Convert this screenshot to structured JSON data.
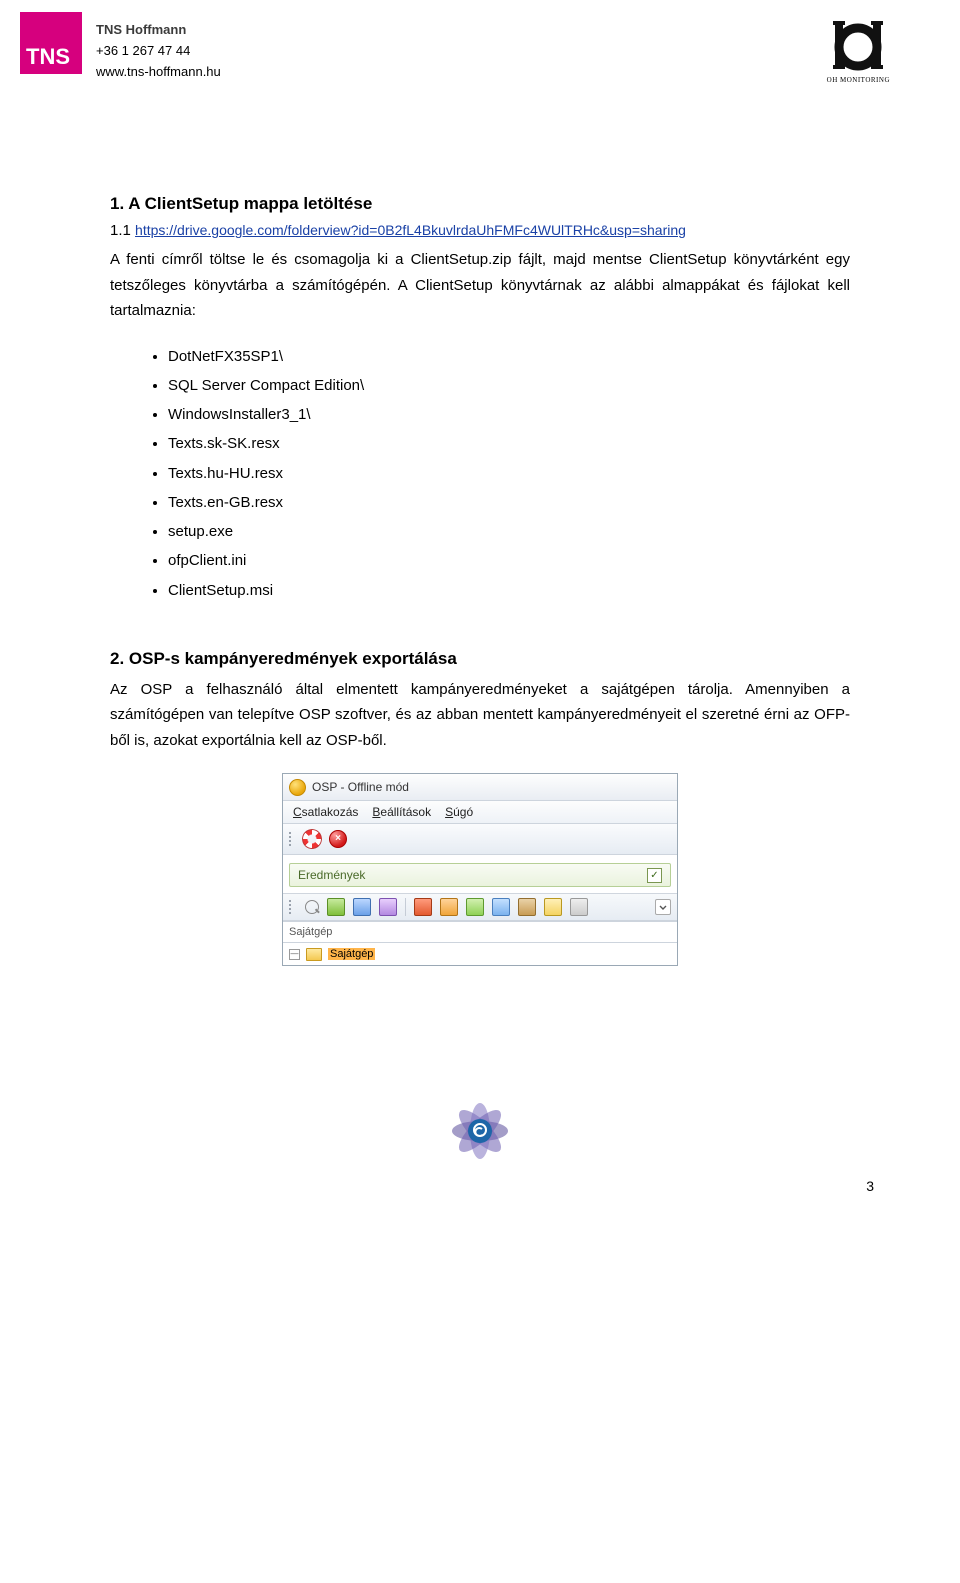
{
  "header": {
    "tns_logo": "TNS",
    "company": "TNS Hoffmann",
    "phone": "+36 1 267 47 44",
    "site": "www.tns-hoffmann.hu",
    "oh_caption": "OH MONITORING"
  },
  "section1": {
    "title": "1. A ClientSetup mappa letöltése",
    "subline_prefix": "1.1 ",
    "url": "https://drive.google.com/folderview?id=0B2fL4BkuvlrdaUhFMFc4WUlTRHc&usp=sharing",
    "para": "A fenti címről töltse le és csomagolja ki a ClientSetup.zip fájlt, majd mentse ClientSetup könyvtárként egy tetszőleges könyvtárba a számítógépén. A ClientSetup könyvtárnak az alábbi almappákat és fájlokat kell tartalmaznia:",
    "files": [
      "DotNetFX35SP1\\",
      "SQL Server Compact Edition\\",
      "WindowsInstaller3_1\\",
      "Texts.sk-SK.resx",
      "Texts.hu-HU.resx",
      "Texts.en-GB.resx",
      "setup.exe",
      "ofpClient.ini",
      "ClientSetup.msi"
    ]
  },
  "section2": {
    "title": "2. OSP-s kampányeredmények exportálása",
    "para": "Az OSP a felhasználó által elmentett kampányeredményeket a sajátgépen tárolja. Amennyiben a számítógépen van telepítve OSP szoftver, és az abban mentett kampányeredményeit el szeretné érni az OFP-ből is, azokat exportálnia kell az OSP-ből."
  },
  "app": {
    "title": "OSP - Offline mód",
    "menu": {
      "m1": "Csatlakozás",
      "m2": "Beállítások",
      "m3": "Súgó",
      "u1": "C",
      "u2": "B",
      "u3": "S"
    },
    "panel_label": "Eredmények",
    "input_value": "Sajátgép",
    "tree_label": "Sajátgép",
    "tree_toggle": "—"
  },
  "page_number": "3"
}
